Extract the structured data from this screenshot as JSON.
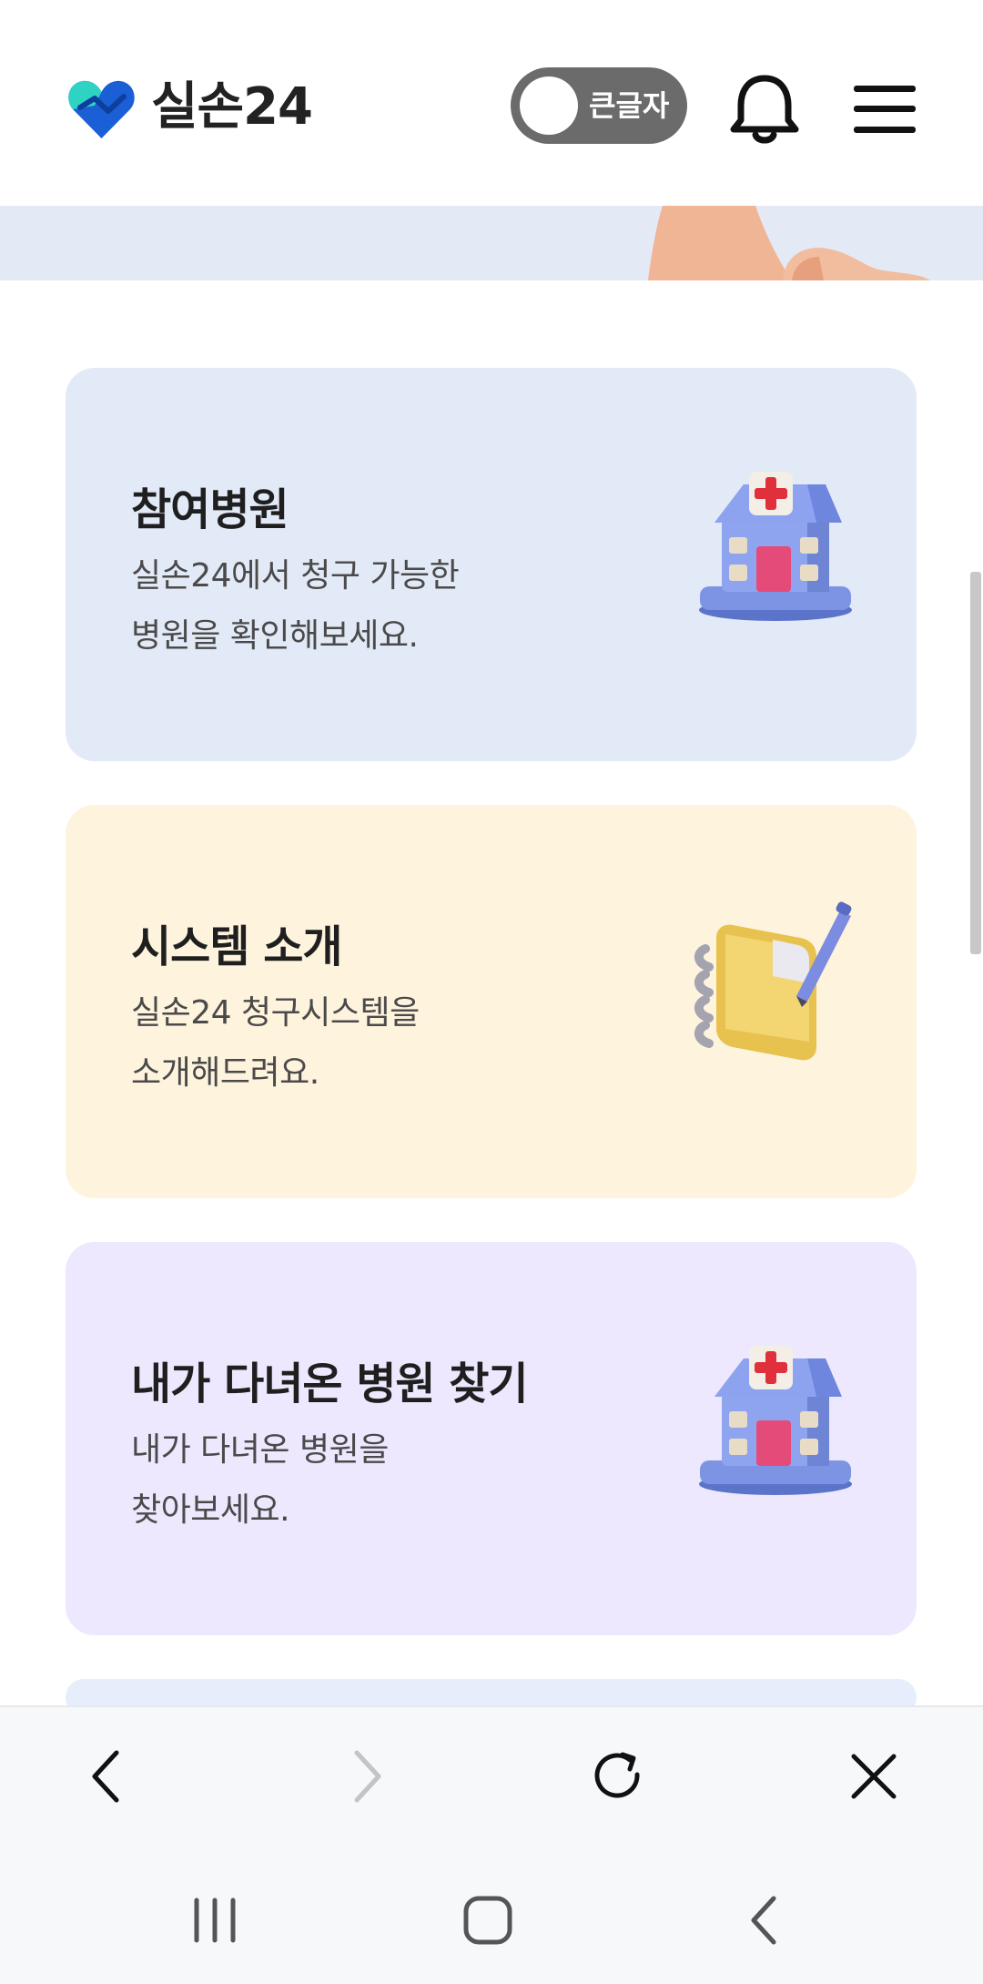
{
  "header": {
    "brand": "실손24",
    "toggle_label": "큰글자",
    "icons": {
      "logo": "heart-logo",
      "bell": "bell-icon",
      "menu": "hamburger-menu-icon"
    }
  },
  "cards": [
    {
      "title": "참여병원",
      "desc_lines": [
        "실손24에서 청구 가능한",
        "병원을 확인해보세요."
      ],
      "icon": "hospital-icon",
      "bg": "#e3eaf7"
    },
    {
      "title": "시스템 소개",
      "desc_lines": [
        "실손24 청구시스템을",
        "소개해드려요."
      ],
      "icon": "notebook-pen-icon",
      "bg": "#fef3dd"
    },
    {
      "title": "내가 다녀온 병원 찾기",
      "desc_lines": [
        "내가 다녀온 병원을",
        "찾아보세요."
      ],
      "icon": "hospital-icon",
      "bg": "#ede8fd"
    }
  ],
  "browser_toolbar": [
    "back-icon",
    "forward-icon",
    "reload-icon",
    "close-icon"
  ],
  "system_nav": [
    "recent-apps-icon",
    "home-icon",
    "back-nav-icon"
  ],
  "colors": {
    "brand_teal": "#2fd3c3",
    "brand_blue": "#1a5fd6",
    "toggle": "#6b6b6b"
  }
}
